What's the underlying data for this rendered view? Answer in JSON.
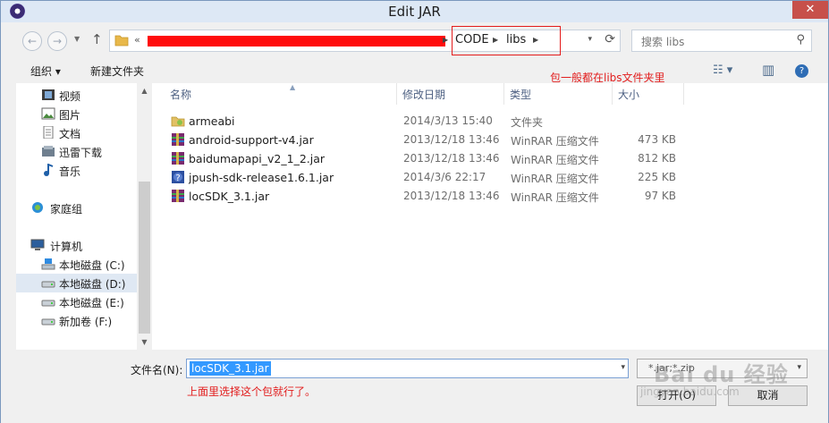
{
  "window": {
    "title": "Edit JAR",
    "close_glyph": "✕"
  },
  "nav": {
    "back_glyph": "←",
    "forward_glyph": "→",
    "recent_glyph": "▼",
    "up_glyph": "↑",
    "overflow_glyph": "«",
    "breadcrumb": [
      "CODE",
      "libs"
    ],
    "separator_glyph": "▶",
    "dropdown_glyph": "▾",
    "refresh_glyph": "⟳",
    "search_placeholder": "搜索 libs",
    "search_glyph": "⚲"
  },
  "toolbar": {
    "organize_label": "组织 ▾",
    "new_folder_label": "新建文件夹",
    "annotation": "包一般都在libs文件夹里",
    "view_glyph": "☷ ▾",
    "pane_glyph": "▥",
    "help_glyph": "?"
  },
  "sidebar": {
    "items": [
      {
        "label": "视频"
      },
      {
        "label": "图片"
      },
      {
        "label": "文档"
      },
      {
        "label": "迅雷下载"
      },
      {
        "label": "音乐"
      },
      {
        "label": "家庭组"
      },
      {
        "label": "计算机"
      },
      {
        "label": "本地磁盘 (C:)"
      },
      {
        "label": "本地磁盘 (D:)"
      },
      {
        "label": "本地磁盘 (E:)"
      },
      {
        "label": "新加卷 (F:)"
      }
    ],
    "scroll_up_glyph": "▲",
    "scroll_down_glyph": "▼"
  },
  "columns": {
    "name": "名称",
    "date": "修改日期",
    "type": "类型",
    "size": "大小",
    "sort_glyph": "▲"
  },
  "files": [
    {
      "name": "armeabi",
      "date": "2014/3/13 15:40",
      "type": "文件夹",
      "size": "",
      "kind": "folder"
    },
    {
      "name": "android-support-v4.jar",
      "date": "2013/12/18 13:46",
      "type": "WinRAR 压缩文件",
      "size": "473 KB",
      "kind": "archive"
    },
    {
      "name": "baidumapapi_v2_1_2.jar",
      "date": "2013/12/18 13:46",
      "type": "WinRAR 压缩文件",
      "size": "812 KB",
      "kind": "archive"
    },
    {
      "name": "jpush-sdk-release1.6.1.jar",
      "date": "2014/3/6 22:17",
      "type": "WinRAR 压缩文件",
      "size": "225 KB",
      "kind": "archive"
    },
    {
      "name": "locSDK_3.1.jar",
      "date": "2013/12/18 13:46",
      "type": "WinRAR 压缩文件",
      "size": "97 KB",
      "kind": "archive"
    }
  ],
  "bottom": {
    "filename_label": "文件名(N):",
    "filename_value": "locSDK_3.1.jar",
    "filename_drop_glyph": "▾",
    "annotation": "上面里选择这个包就行了。",
    "filetype_value": "*.jar;*.zip",
    "filetype_drop_glyph": "▾",
    "open_label": "打开(O)",
    "cancel_label": "取消"
  },
  "watermark": {
    "main": "Bai du 经验",
    "sub": "jingyan.baidu.com"
  },
  "colors": {
    "annotation_red": "#e21d1d",
    "selection_blue": "#3399ff",
    "redaction": "#ff0c0c"
  }
}
